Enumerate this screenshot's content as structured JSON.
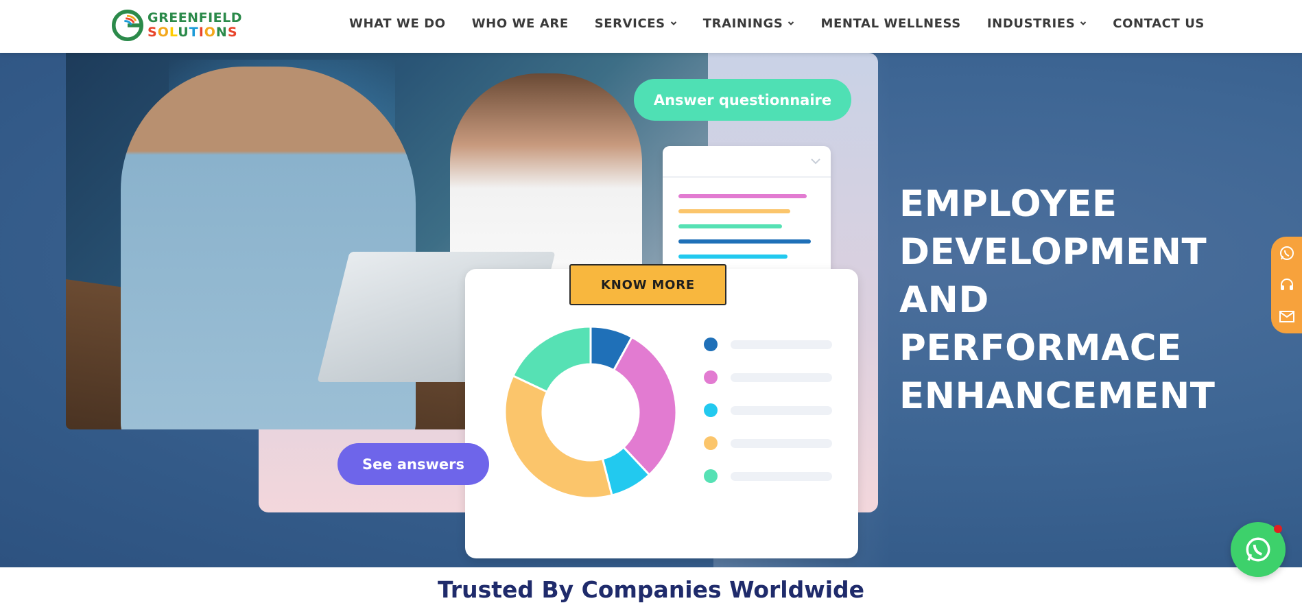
{
  "brand": {
    "line1": "GREENFIELD",
    "line2_letters": [
      "S",
      "O",
      "L",
      "U",
      "T",
      "I",
      "O",
      "N",
      "S"
    ],
    "line2_colors": [
      "#e8452c",
      "#f3a71b",
      "#ffcc00",
      "#2b8a4a",
      "#1c9bd8",
      "#e8452c",
      "#f3a71b",
      "#2b8a4a",
      "#e8452c"
    ],
    "icon": "greenfield-logo-mark"
  },
  "nav": {
    "items": [
      {
        "label": "WHAT WE DO",
        "dropdown": false
      },
      {
        "label": "WHO WE ARE",
        "dropdown": false
      },
      {
        "label": "SERVICES",
        "dropdown": true
      },
      {
        "label": "TRAININGS",
        "dropdown": true
      },
      {
        "label": "MENTAL WELLNESS",
        "dropdown": false
      },
      {
        "label": "INDUSTRIES",
        "dropdown": true
      },
      {
        "label": "CONTACT US",
        "dropdown": false
      }
    ]
  },
  "hero": {
    "pill_answer": "Answer questionnaire",
    "pill_see": "See answers",
    "cta": "KNOW MORE",
    "headline": [
      "EMPLOYEE",
      "DEVELOPMENT",
      "AND PERFORMACE",
      "ENHANCEMENT"
    ],
    "form_line_colors": [
      "#e27bd1",
      "#fbc56b",
      "#56e1b4",
      "#1f70b8",
      "#22c9ef"
    ],
    "donut_colors": [
      "#1f70b8",
      "#e27bd1",
      "#22c9ef",
      "#fbc56b",
      "#56e1b4"
    ],
    "donut_shares": [
      0.08,
      0.3,
      0.08,
      0.36,
      0.18
    ]
  },
  "side_contact": {
    "icons": [
      "whatsapp-icon",
      "headset-icon",
      "mail-icon"
    ]
  },
  "floating": {
    "icon": "whatsapp-icon"
  },
  "section": {
    "trusted_heading": "Trusted By Companies Worldwide"
  },
  "colors": {
    "accent": "#f8b73e",
    "hero_bg": "#3e6694",
    "heading_navy": "#1f2b6b"
  }
}
